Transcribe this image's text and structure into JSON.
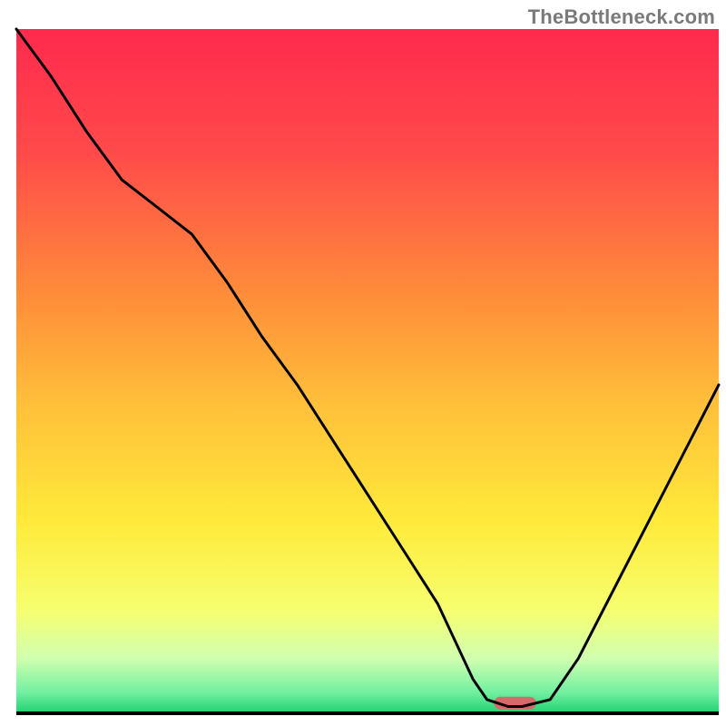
{
  "attribution": "TheBottleneck.com",
  "chart_data": {
    "type": "line",
    "title": "",
    "xlabel": "",
    "ylabel": "",
    "xlim": [
      0,
      100
    ],
    "ylim": [
      0,
      100
    ],
    "grid": false,
    "legend": false,
    "series": [
      {
        "name": "curve",
        "x": [
          0,
          5,
          10,
          15,
          20,
          25,
          30,
          35,
          40,
          45,
          50,
          55,
          60,
          65,
          67,
          70,
          72,
          76,
          80,
          85,
          90,
          95,
          100
        ],
        "y": [
          100,
          93,
          85,
          78,
          74,
          70,
          63,
          55,
          48,
          40,
          32,
          24,
          16,
          5,
          2,
          1,
          1,
          2,
          8,
          18,
          28,
          38,
          48
        ]
      }
    ],
    "marker": {
      "name": "optimal-region",
      "x_center": 71,
      "y": 1.5,
      "width": 6,
      "color": "#d66a6a"
    },
    "background_gradient": {
      "type": "vertical",
      "stops": [
        {
          "pos": 0.0,
          "color": "#ff2a4d"
        },
        {
          "pos": 0.18,
          "color": "#ff4a4a"
        },
        {
          "pos": 0.38,
          "color": "#ff8a3a"
        },
        {
          "pos": 0.55,
          "color": "#ffc03a"
        },
        {
          "pos": 0.72,
          "color": "#ffea3a"
        },
        {
          "pos": 0.85,
          "color": "#f6ff70"
        },
        {
          "pos": 0.92,
          "color": "#d0ffb0"
        },
        {
          "pos": 0.97,
          "color": "#70f0a0"
        },
        {
          "pos": 1.0,
          "color": "#20d070"
        }
      ]
    }
  }
}
